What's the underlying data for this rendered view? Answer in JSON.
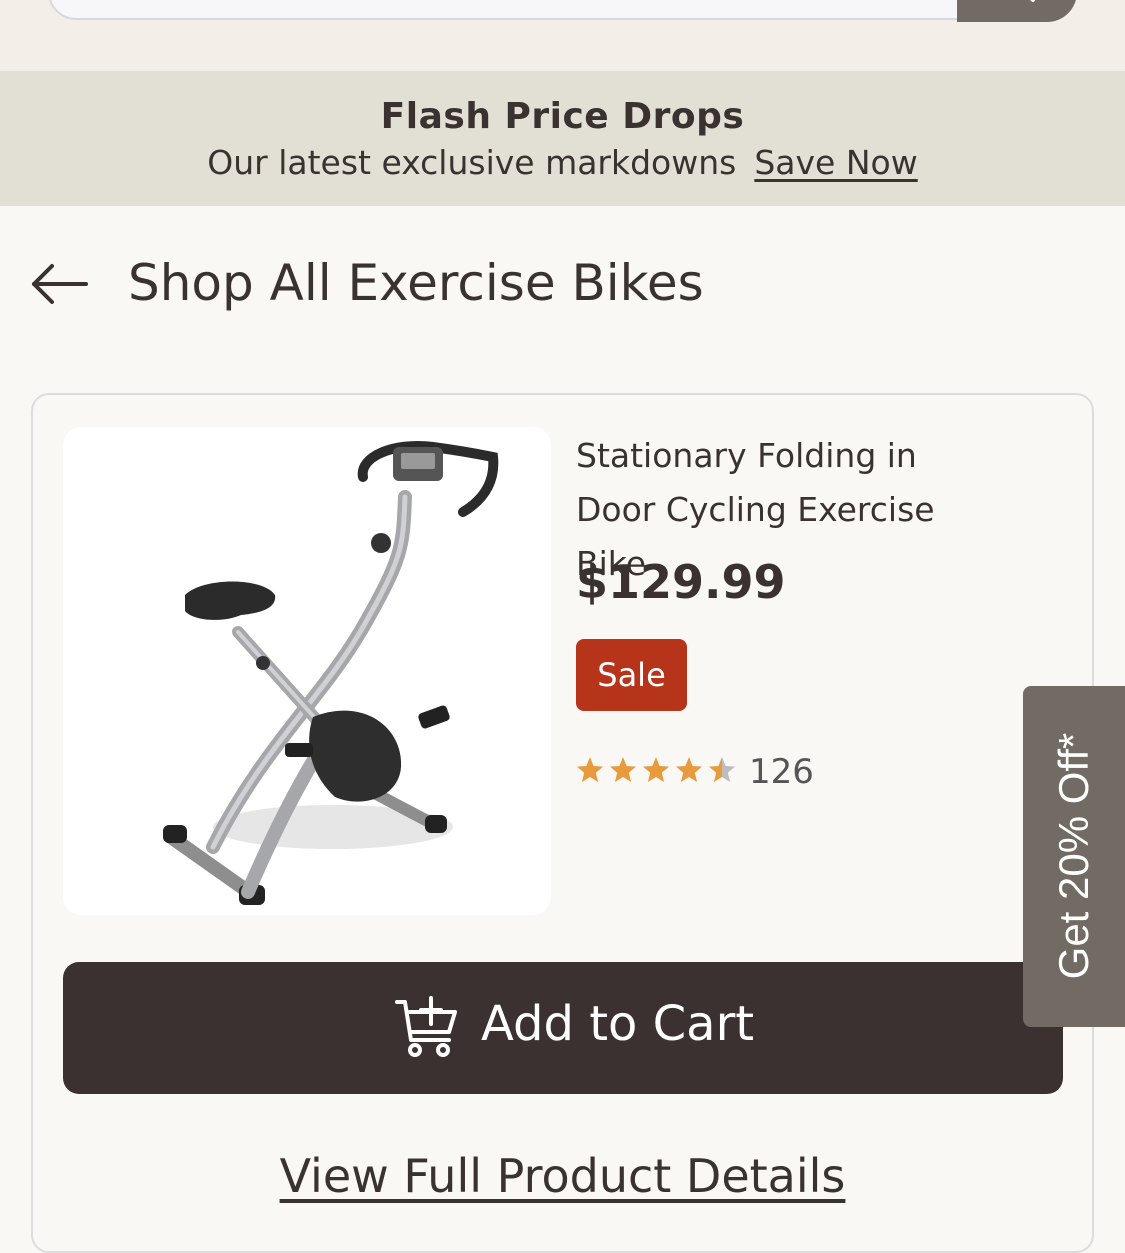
{
  "promo": {
    "title": "Flash Price Drops",
    "subtitle": "Our latest exclusive markdowns",
    "link": "Save Now"
  },
  "back": {
    "label": "Shop All Exercise Bikes",
    "icon": "arrow-left-icon"
  },
  "product": {
    "title": "Stationary Folding in Door Cycling Exercise Bike",
    "price": "$129.99",
    "badge": "Sale",
    "rating": 4.5,
    "rating_max": 5,
    "review_count": "126",
    "image_icon": "exercise-bike-image"
  },
  "actions": {
    "add_to_cart": "Add to Cart",
    "cart_icon": "cart-plus-icon",
    "view_details": "View Full Product Details"
  },
  "side_tab": {
    "label": "Get 20% Off*"
  },
  "colors": {
    "sale_badge": "#b5341a",
    "add_to_cart_bg": "#3a3130",
    "star": "#e89a3c",
    "side_tab_bg": "#716b63",
    "promo_bg": "#e2e0d4"
  }
}
